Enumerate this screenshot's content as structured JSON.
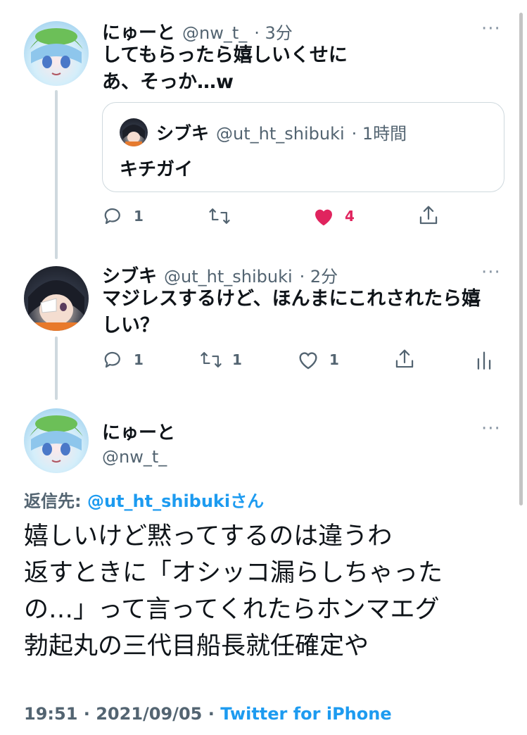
{
  "tweet1": {
    "name": "にゅーと",
    "handle": "@nw_t_",
    "time": "· 3分",
    "text_line1": "してもらったら嬉しいくせに",
    "text_line2": "あ、そっか…w",
    "quote": {
      "name": "シブキ",
      "handle": "@ut_ht_shibuki",
      "time": "· 1時間",
      "text": "キチガイ"
    },
    "actions": {
      "reply": "1",
      "retweet": "",
      "like": "4",
      "share": ""
    },
    "like_color": "#e0245e"
  },
  "tweet2": {
    "name": "シブキ",
    "handle": "@ut_ht_shibuki",
    "time": "· 2分",
    "text_line1": "マジレスするけど、ほんまにこれされたら嬉",
    "text_line2": "しい？",
    "actions": {
      "reply": "1",
      "retweet": "1",
      "like": "1"
    }
  },
  "main": {
    "name": "にゅーと",
    "handle": "@nw_t_",
    "reply_label": "返信先: ",
    "reply_to": "@ut_ht_shibukiさん",
    "line1": "嬉しいけど黙ってするのは違うわ",
    "line2": "返すときに「オシッコ漏らしちゃった",
    "line3": "の…」って言ってくれたらホンマエグ",
    "line4": "勃起丸の三代目船長就任確定や",
    "time": "19:51 · 2021/09/05 · ",
    "source": "Twitter for iPhone"
  },
  "menu_dots": "···",
  "colors": {
    "accent": "#1d9bf0",
    "like": "#e0245e",
    "muted": "#536471"
  }
}
